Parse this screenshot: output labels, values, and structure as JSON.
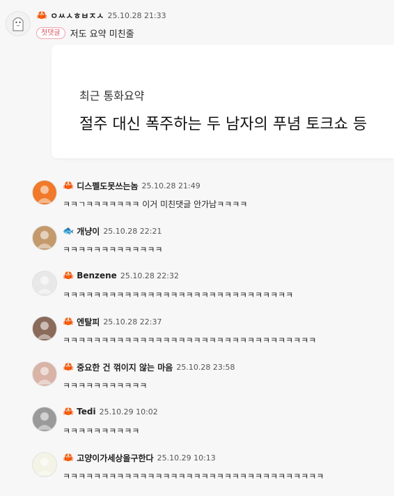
{
  "top_comment": {
    "nickname": "ㅇㅆㅅㅎㅂㅈㅅ",
    "date": "25.10.28 21:33",
    "badge": "첫댓글",
    "text": "저도 요약 미친줄",
    "badge_icon": "crab-icon"
  },
  "card": {
    "subtitle": "최근 통화요약",
    "title": "절주 대신 폭주하는 두 남자의 푸념 토크쇼 등"
  },
  "replies": [
    {
      "nickname": "디스펠도못쓰는놈",
      "date": "25.10.28 21:49",
      "text": "ㅋㅋㄱㅋㅋㅋㅋㅋㅋㅋ 이거 미친댓글 안가남ㅋㅋㅋㅋ",
      "badge_icon": "crab-icon",
      "avatar_color": "#f07a2a"
    },
    {
      "nickname": "개냥이",
      "date": "25.10.28 22:21",
      "text": "ㅋㅋㅋㅋㅋㅋㅋㅋㅋㅋㅋㅋㅋ",
      "badge_icon": "fish-icon",
      "avatar_color": "#c49a6c"
    },
    {
      "nickname": "Benzene",
      "date": "25.10.28 22:32",
      "text": "ㅋㅋㅋㅋㅋㅋㅋㅋㅋㅋㅋㅋㅋㅋㅋㅋㅋㅋㅋㅋㅋㅋㅋㅋㅋㅋㅋㅋㅋㅋ",
      "badge_icon": "crab-icon",
      "avatar_color": "#e8e8e8"
    },
    {
      "nickname": "엔탈피",
      "date": "25.10.28 22:37",
      "text": "ㅋㅋㅋㅋㅋㅋㅋㅋㅋㅋㅋㅋㅋㅋㅋㅋㅋㅋㅋㅋㅋㅋㅋㅋㅋㅋㅋㅋㅋㅋㅋㅋㅋ",
      "badge_icon": "crab-icon",
      "avatar_color": "#8a6a5a"
    },
    {
      "nickname": "중요한 건 꺾이지 않는 마음",
      "date": "25.10.28 23:58",
      "text": "ㅋㅋㅋㅋㅋㅋㅋㅋㅋㅋㅋ",
      "badge_icon": "crab-icon",
      "avatar_color": "#d9b3a6"
    },
    {
      "nickname": "Tedi",
      "date": "25.10.29 10:02",
      "text": "ㅋㅋㅋㅋㅋㅋㅋㅋㅋㅋ",
      "badge_icon": "crab-icon",
      "avatar_color": "#9a9a9a"
    },
    {
      "nickname": "고양이가세상을구한다",
      "date": "25.10.29 10:13",
      "text": "ㅋㅋㅋㅋㅋㅋㅋㅋㅋㅋㅋㅋㅋㅋㅋㅋㅋㅋㅋㅋㅋㅋㅋㅋㅋㅋㅋㅋㅋㅋㅋㅋㅋㅋ",
      "badge_icon": "crab-icon",
      "avatar_color": "#f3f3e6"
    }
  ]
}
